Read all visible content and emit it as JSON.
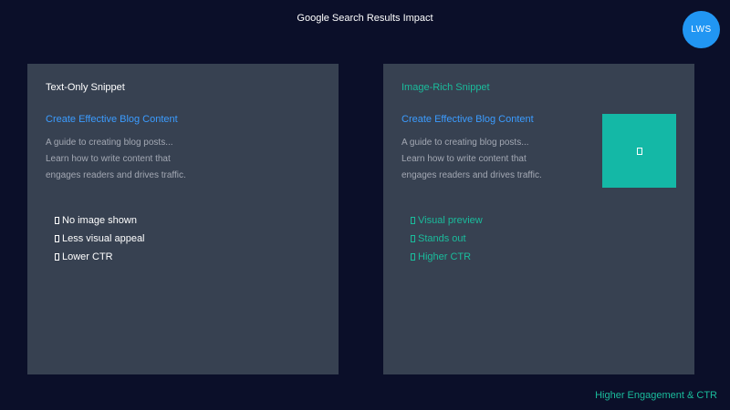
{
  "header": {
    "title": "Google Search Results Impact",
    "avatar_initials": "LWS"
  },
  "colors": {
    "background": "#0b0f29",
    "panel": "#374151",
    "accent_teal": "#1abc9c",
    "link_blue": "#3b9cff",
    "avatar_blue": "#2196f3",
    "thumbnail_teal": "#14b8a6"
  },
  "panels": {
    "text_only": {
      "heading": "Text-Only Snippet",
      "snippet": {
        "link": "Create Effective Blog Content",
        "description_lines": [
          "A guide to creating blog posts...",
          "Learn how to write content that",
          "engages readers and drives traffic."
        ]
      },
      "features": [
        {
          "icon": "box-glyph-icon",
          "label": "No image shown"
        },
        {
          "icon": "box-glyph-icon",
          "label": "Less visual appeal"
        },
        {
          "icon": "box-glyph-icon",
          "label": "Lower CTR"
        }
      ]
    },
    "image_rich": {
      "heading": "Image-Rich Snippet",
      "snippet": {
        "link": "Create Effective Blog Content",
        "description_lines": [
          "A guide to creating blog posts...",
          "Learn how to write content that",
          "engages readers and drives traffic."
        ],
        "thumbnail_icon": "image-placeholder-icon"
      },
      "features": [
        {
          "icon": "box-glyph-icon",
          "label": "Visual preview"
        },
        {
          "icon": "box-glyph-icon",
          "label": "Stands out"
        },
        {
          "icon": "box-glyph-icon",
          "label": "Higher CTR"
        }
      ]
    }
  },
  "footer": {
    "caption": "Higher Engagement & CTR"
  }
}
